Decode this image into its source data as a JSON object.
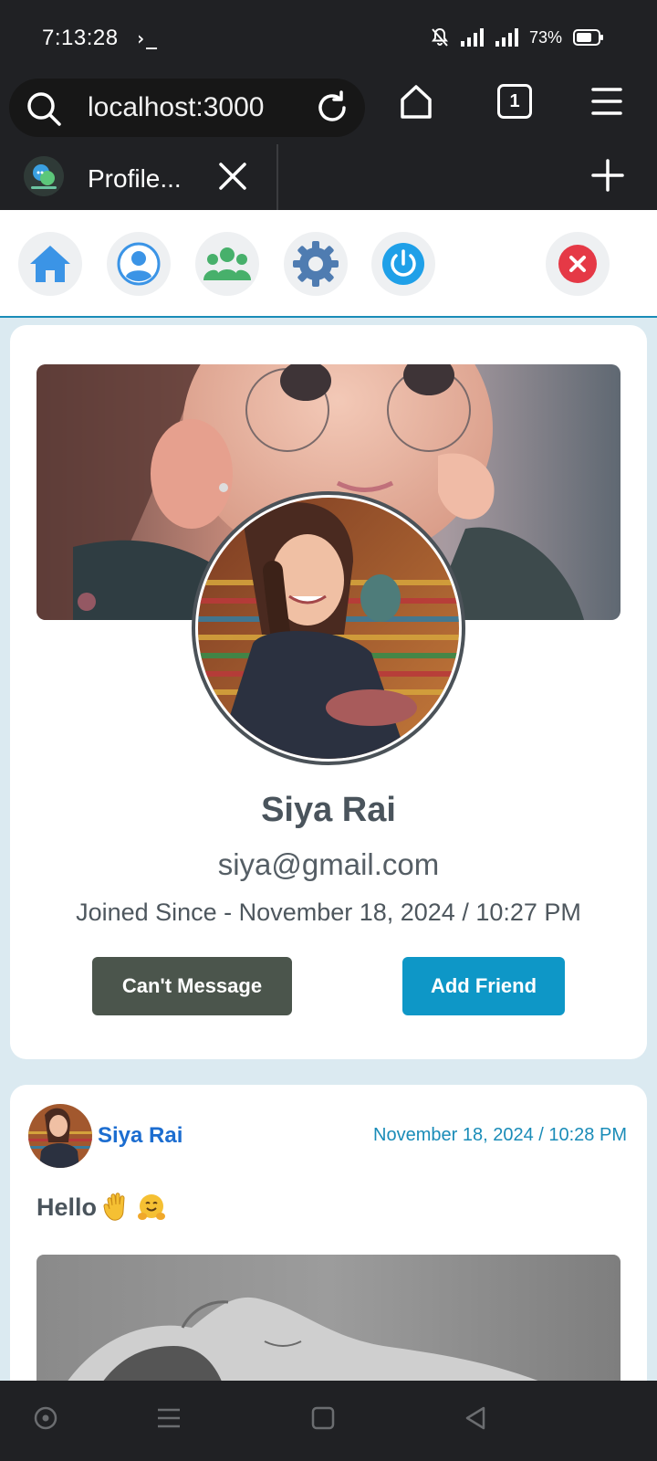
{
  "status_bar": {
    "time": "7:13:28",
    "terminal_glyph": "›_",
    "battery_percent": "73%",
    "battery_level": 0.73
  },
  "browser": {
    "url": "localhost:3000",
    "tab_count": "1",
    "tab_title": "Profile..."
  },
  "toolbar": {
    "icons": [
      "home-icon",
      "profile-icon",
      "friends-icon",
      "settings-icon",
      "power-icon",
      "close-icon"
    ]
  },
  "profile": {
    "name": "Siya Rai",
    "email": "siya@gmail.com",
    "joined": "Joined Since - November 18, 2024 / 10:27 PM",
    "message_button": "Can't Message",
    "friend_button": "Add Friend"
  },
  "post": {
    "author": "Siya Rai",
    "date": "November 18, 2024 / 10:28 PM",
    "text": "Hello"
  },
  "colors": {
    "accent": "#0e97c7",
    "author_link": "#1c6dd0",
    "message_button": "#4b554c",
    "close_red": "#e53946",
    "page_bg": "#dbeaf1"
  }
}
